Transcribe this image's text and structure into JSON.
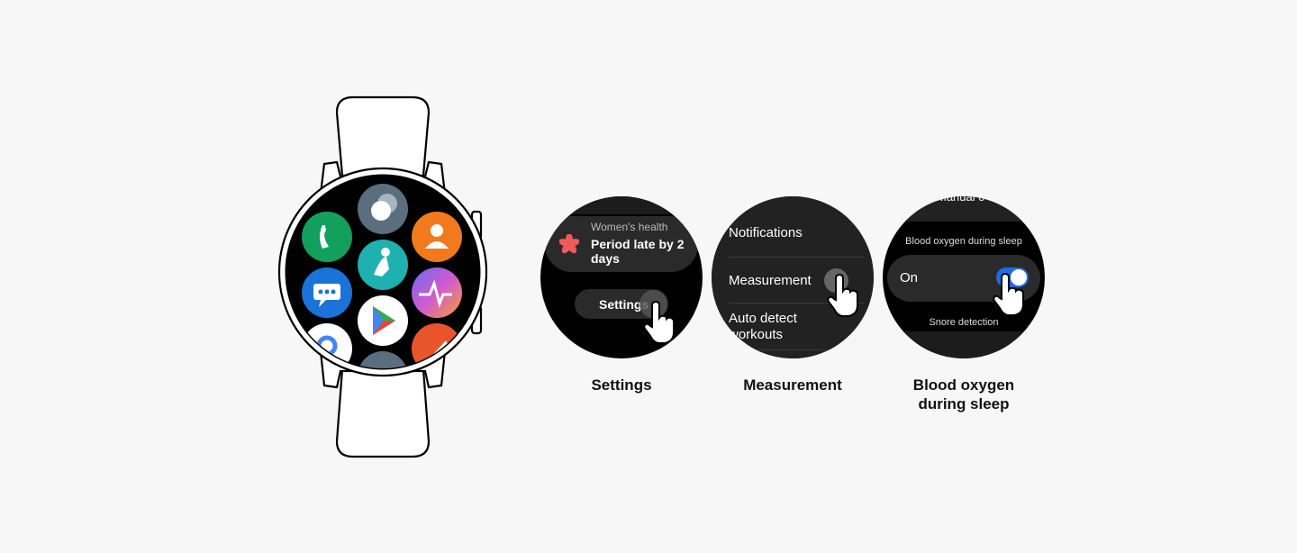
{
  "watch": {
    "apps": [
      {
        "icon": "toggle-app-icon",
        "color": "#5a6e7f"
      },
      {
        "icon": "phone-icon",
        "color": "#12a05c"
      },
      {
        "icon": "contacts-icon",
        "color": "#f07a1c"
      },
      {
        "icon": "fitness-icon",
        "color": "#1fb0b0"
      },
      {
        "icon": "messages-icon",
        "color": "#1a73d9"
      },
      {
        "icon": "health-icon",
        "color": "#a05be0"
      },
      {
        "icon": "play-store-icon",
        "color": "#ffffff"
      },
      {
        "icon": "google-maps-icon",
        "color": "#ffffff"
      },
      {
        "icon": "rocket-app-icon",
        "color": "#e9552a"
      },
      {
        "icon": "settings-app-icon",
        "color": "#5a6e7f"
      }
    ]
  },
  "screens": [
    {
      "caption": "Settings",
      "card_title": "Women's health",
      "card_text_1": "Period late by 2",
      "card_text_2": "days",
      "button": "Settings"
    },
    {
      "caption": "Measurement",
      "items": [
        "Notifications",
        "Measurement",
        "Auto detect",
        "workouts"
      ]
    },
    {
      "caption_1": "Blood oxygen",
      "caption_2": "during sleep",
      "top_partial": "Manual c",
      "section_title": "Blood oxygen during sleep",
      "toggle_label": "On",
      "toggle_on": true,
      "toggle_color": "#1a6fe0",
      "next_item": "Snore detection"
    }
  ]
}
